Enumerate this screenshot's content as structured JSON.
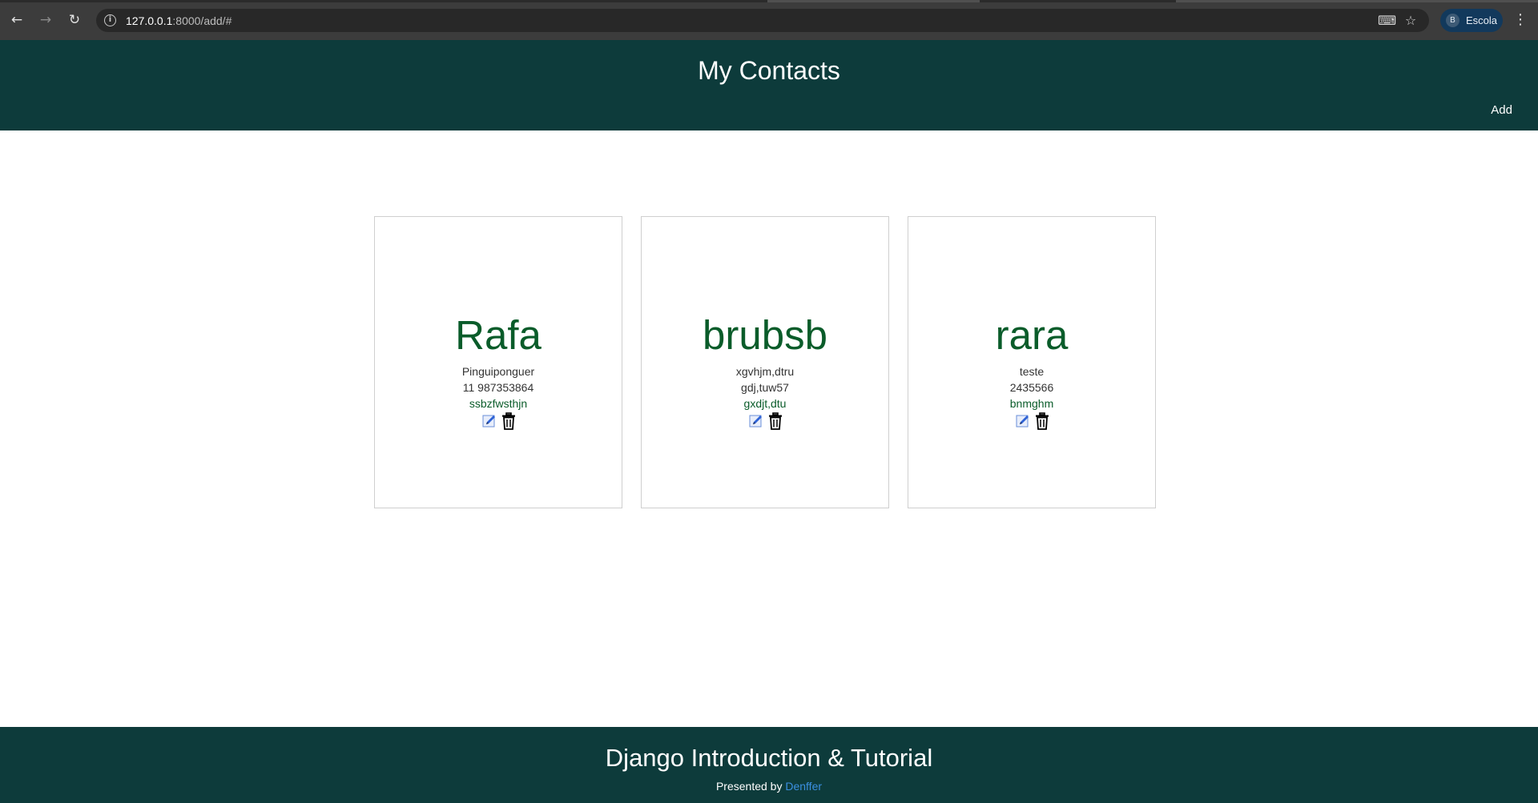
{
  "browser": {
    "url_host": "127.0.0.1",
    "url_path": ":8000/add/#",
    "profile_initial": "B",
    "profile_name": "Escola"
  },
  "header": {
    "title": "My Contacts",
    "add_label": "Add"
  },
  "contacts": [
    {
      "name": "Rafa",
      "line1": "Pinguiponguer",
      "line2": "11 987353864",
      "line3": "ssbzfwsthjn"
    },
    {
      "name": "brubsb",
      "line1": "xgvhjm,dtru",
      "line2": "gdj,tuw57",
      "line3": "gxdjt,dtu"
    },
    {
      "name": "rara",
      "line1": "teste",
      "line2": "2435566",
      "line3": "bnmghm"
    }
  ],
  "footer": {
    "title": "Django Introduction & Tutorial",
    "presented_by": "Presented by",
    "author": "Denffer"
  },
  "colors": {
    "header_bg": "#0d3b3b",
    "name_green": "#0a5c2a",
    "link_blue": "#3b8fe0"
  }
}
